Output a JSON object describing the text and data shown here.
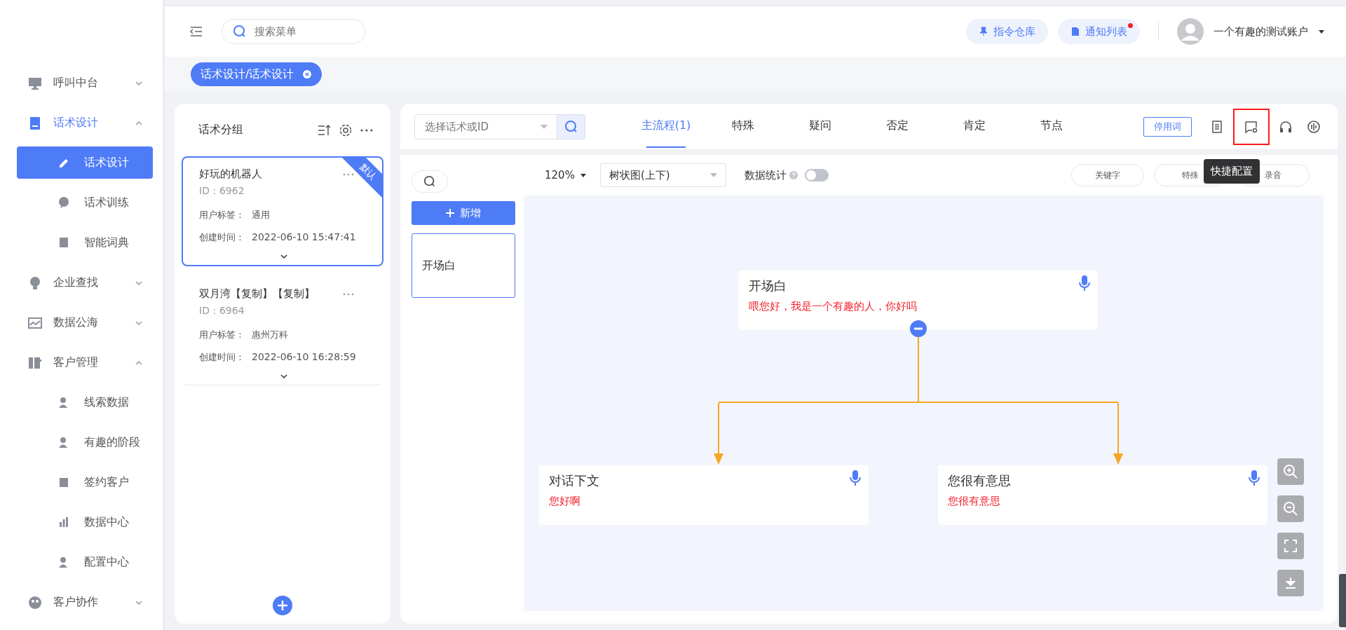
{
  "sidebar": {
    "items": [
      {
        "label": "呼叫中台",
        "expanded": false,
        "selected": false
      },
      {
        "label": "话术设计",
        "expanded": true,
        "selected": true,
        "children": [
          {
            "label": "话术设计",
            "selected": true
          },
          {
            "label": "话术训练",
            "selected": false
          },
          {
            "label": "智能词典",
            "selected": false
          }
        ]
      },
      {
        "label": "企业查找",
        "expanded": false,
        "selected": false
      },
      {
        "label": "数据公海",
        "expanded": false,
        "selected": false
      },
      {
        "label": "客户管理",
        "expanded": true,
        "selected": false,
        "children": [
          {
            "label": "线索数据",
            "selected": false
          },
          {
            "label": "有趣的阶段",
            "selected": false
          },
          {
            "label": "签约客户",
            "selected": false
          },
          {
            "label": "数据中心",
            "selected": false
          },
          {
            "label": "配置中心",
            "selected": false
          }
        ]
      },
      {
        "label": "客户协作",
        "expanded": false,
        "selected": false
      }
    ]
  },
  "topbar": {
    "search_placeholder": "搜索菜单",
    "buttons": [
      {
        "label": "指令仓库",
        "notice": false
      },
      {
        "label": "通知列表",
        "notice": true
      }
    ],
    "user": "一个有趣的测试账户"
  },
  "tags": [
    {
      "label": "话术设计/话术设计",
      "selected": true
    }
  ],
  "groups": {
    "title": "话术分组",
    "cards": [
      {
        "name": "好玩的机器人",
        "id": "ID：6962",
        "tag_label": "用户标签：",
        "tag": "通用",
        "time_label": "创建时间：",
        "time": "2022-06-10 15:47:41",
        "ribbon": "默认",
        "selected": true
      },
      {
        "name": "双月湾【复制】【复制】",
        "id": "ID：6964",
        "tag_label": "用户标签：",
        "tag": "惠州万科",
        "time_label": "创建时间：",
        "time": "2022-06-10 16:28:59",
        "selected": false
      }
    ]
  },
  "main": {
    "select_placeholder": "选择话术或ID",
    "tabs": [
      {
        "label": "主流程(1)",
        "selected": true
      },
      {
        "label": "特殊",
        "selected": false
      },
      {
        "label": "疑问",
        "selected": false
      },
      {
        "label": "否定",
        "selected": false
      },
      {
        "label": "肯定",
        "selected": false
      },
      {
        "label": "节点",
        "selected": false
      }
    ],
    "stopwords_button": "停用词",
    "tool_icons": [
      {
        "highlighted": false
      },
      {
        "highlighted": true
      },
      {
        "highlighted": false
      },
      {
        "highlighted": false
      }
    ],
    "tooltip": "快捷配置",
    "add_button": "新增",
    "node_list": [
      {
        "label": "开场白",
        "selected": true
      }
    ],
    "canvas_toolbar": {
      "zoom": "120%",
      "layout": "树状图(上下)",
      "stats_label": "数据统计",
      "stats_on": false,
      "filters": [
        "关键字",
        "特殊",
        "录音"
      ]
    },
    "tree": {
      "title": "开场白",
      "text": "喂您好，我是一个有趣的人，你好吗",
      "collapsed": false,
      "children": [
        {
          "title": "对话下文",
          "text": "您好啊"
        },
        {
          "title": "您很有意思",
          "text": "您很有意思"
        }
      ]
    }
  }
}
